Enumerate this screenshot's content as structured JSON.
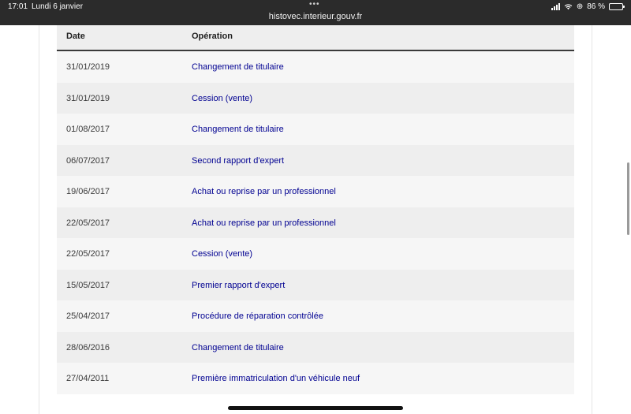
{
  "status_bar": {
    "time": "17:01",
    "date": "Lundi 6 janvier",
    "url": "histovec.interieur.gouv.fr",
    "battery": "86 %",
    "battery_level": 0.86,
    "icons": [
      "signal-icon",
      "wifi-icon",
      "orientation-lock-icon",
      "battery-icon"
    ]
  },
  "table": {
    "headers": {
      "date": "Date",
      "operation": "Opération"
    },
    "rows": [
      {
        "date": "31/01/2019",
        "operation": "Changement de titulaire"
      },
      {
        "date": "31/01/2019",
        "operation": "Cession (vente)"
      },
      {
        "date": "01/08/2017",
        "operation": "Changement de titulaire"
      },
      {
        "date": "06/07/2017",
        "operation": "Second rapport d'expert"
      },
      {
        "date": "19/06/2017",
        "operation": "Achat ou reprise par un professionnel"
      },
      {
        "date": "22/05/2017",
        "operation": "Achat ou reprise par un professionnel"
      },
      {
        "date": "22/05/2017",
        "operation": "Cession (vente)"
      },
      {
        "date": "15/05/2017",
        "operation": "Premier rapport d'expert"
      },
      {
        "date": "25/04/2017",
        "operation": "Procédure de réparation contrôlée"
      },
      {
        "date": "28/06/2016",
        "operation": "Changement de titulaire"
      },
      {
        "date": "27/04/2011",
        "operation": "Première immatriculation d'un véhicule neuf"
      }
    ]
  },
  "colors": {
    "link": "#000091",
    "header_bg": "#eeeeee",
    "row_alt_bg": "#f6f6f6",
    "status_bar_bg": "#2b2b2b"
  }
}
